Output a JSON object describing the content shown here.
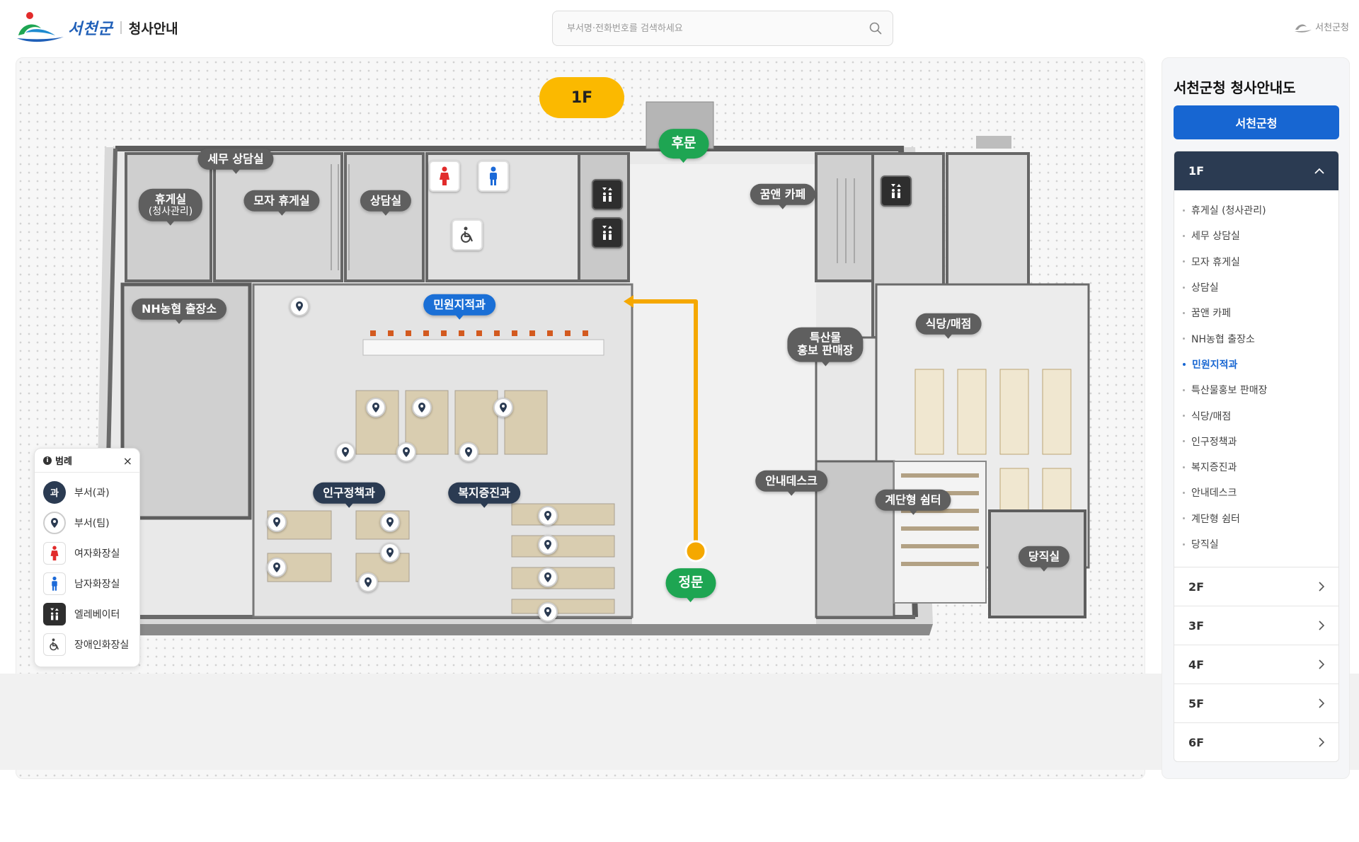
{
  "header": {
    "logo_text": "서천군",
    "logo_sub": "청사안내",
    "search_placeholder": "부서명·전화번호를 검색하세요",
    "top_link": "서천군청"
  },
  "map": {
    "floor_badge": "1F",
    "tags": {
      "rest_room": "휴게실",
      "rest_room_sub": "(청사관리)",
      "tax_consult": "세무 상담실",
      "mother_rest": "모자 휴게실",
      "consult": "상담실",
      "cafe": "꿈앤 카페",
      "nh_bank": "NH농협 출장소",
      "civil_service": "민원지적과",
      "specialty_1": "특산물",
      "specialty_2": "홍보 판매장",
      "restaurant": "식당/매점",
      "population": "인구정책과",
      "welfare": "복지증진과",
      "info_desk": "안내데스크",
      "stair_shelter": "계단형 쉼터",
      "night_duty": "당직실",
      "back_gate": "후문",
      "main_gate": "정문"
    }
  },
  "legend": {
    "title": "범례",
    "close": "×",
    "dept_icon_text": "과",
    "items": [
      "부서(과)",
      "부서(팀)",
      "여자화장실",
      "남자화장실",
      "엘레베이터",
      "장애인화장실"
    ]
  },
  "sidebar": {
    "title": "서천군청 청사안내도",
    "building_button": "서천군청",
    "open_floor": "1F",
    "rooms": [
      "휴게실 (청사관리)",
      "세무 상담실",
      "모자 휴게실",
      "상담실",
      "꿈앤 카페",
      "NH농협 출장소",
      "민원지적과",
      "특산물홍보 판매장",
      "식당/매점",
      "인구정책과",
      "복지증진과",
      "안내데스크",
      "계단형 쉼터",
      "당직실"
    ],
    "active_room": "민원지적과",
    "other_floors": [
      "2F",
      "3F",
      "4F",
      "5F",
      "6F"
    ]
  },
  "colors": {
    "accent_blue": "#1766d2",
    "floor_badge": "#fbb900",
    "gate_green": "#1ea552",
    "route_orange": "#f5a800",
    "dark_navy": "#2b3b52"
  }
}
